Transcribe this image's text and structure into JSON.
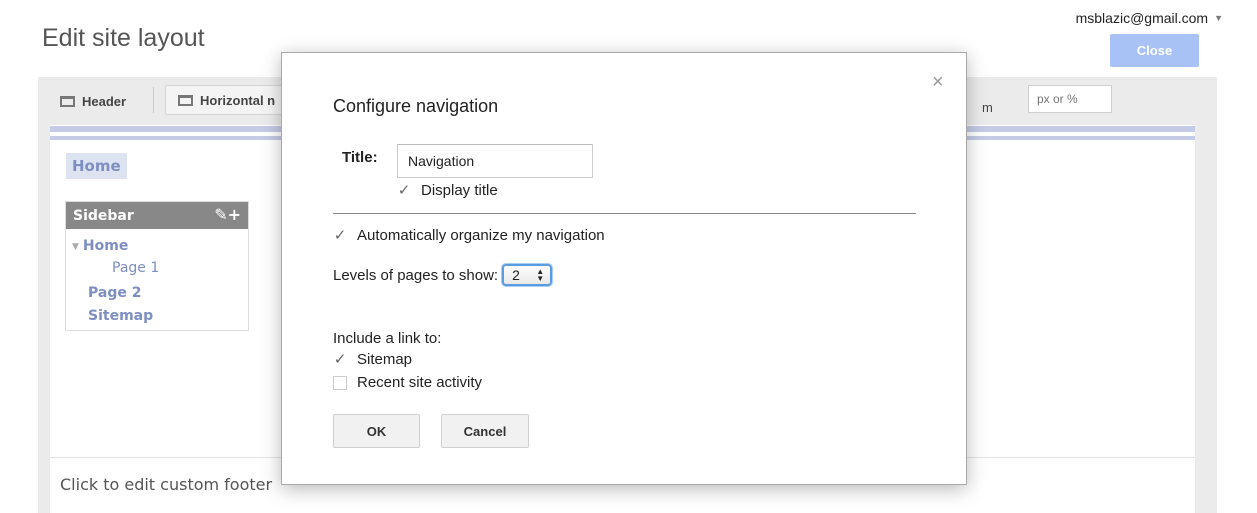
{
  "page": {
    "title": "Edit site layout",
    "account": "msblazic@gmail.com",
    "close_label": "Close"
  },
  "toolbar": {
    "header_label": "Header",
    "horizontal_label": "Horizontal n",
    "margin_label": "m",
    "width_placeholder": "px or %"
  },
  "site": {
    "home_tab": "Home",
    "sidebar_title": "Sidebar",
    "sidebar_tools": "✎+",
    "nav": [
      "Home",
      "Page 1",
      "Page 2",
      "Sitemap"
    ],
    "footer_text": "Click to edit custom footer"
  },
  "dialog": {
    "title": "Configure navigation",
    "close_symbol": "×",
    "title_label": "Title:",
    "title_value": "Navigation",
    "display_title": "Display title",
    "display_title_checked": true,
    "auto_organize": "Automatically organize my navigation",
    "auto_organize_checked": true,
    "levels_label": "Levels of pages to show:",
    "levels_value": "2",
    "include_label": "Include a link to:",
    "sitemap_label": "Sitemap",
    "sitemap_checked": true,
    "recent_label": "Recent site activity",
    "recent_checked": false,
    "ok_label": "OK",
    "cancel_label": "Cancel"
  }
}
